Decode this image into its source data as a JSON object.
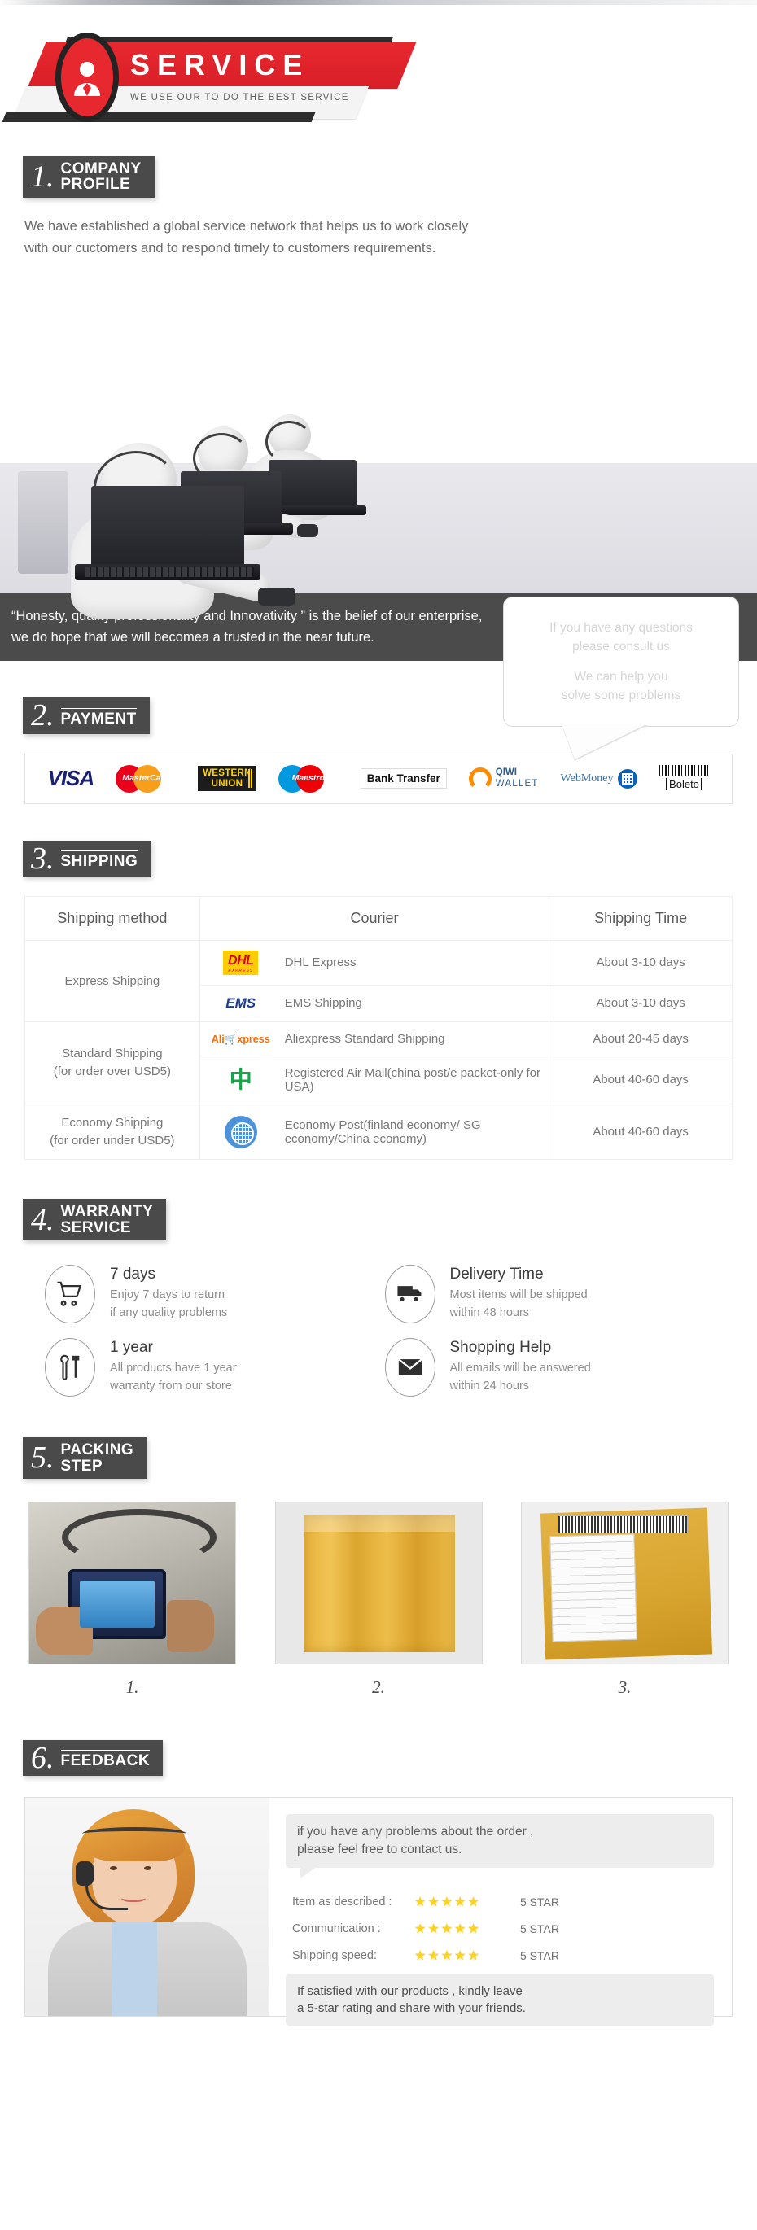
{
  "banner": {
    "title": "SERVICE",
    "subtitle": "WE USE OUR TO DO THE BEST SERVICE",
    "icon": "person-avatar-icon",
    "red": "#e8282f",
    "dark": "#2d2d2d"
  },
  "sections": {
    "profile": {
      "number": "1.",
      "label_line1": "COMPANY",
      "label_line2": "PROFILE",
      "paragraph_line1": "We have established a global service network that helps us to work closely",
      "paragraph_line2": "with our cuctomers and to respond timely to customers requirements.",
      "bubble_line1": "If you have any questions",
      "bubble_line2": "please consult us",
      "bubble_line3": "We can help you",
      "bubble_line4": "solve some problems",
      "quote_line1": "“Honesty, quality professionality and Innovativity ”  is the belief of our enterprise,",
      "quote_line2": "we do hope that we will becomea a trusted in the near future."
    },
    "payment": {
      "number": "2.",
      "label": "PAYMENT",
      "methods": [
        {
          "name": "VISA",
          "icon": "visa-logo"
        },
        {
          "name": "MasterCard",
          "icon": "mastercard-logo"
        },
        {
          "name": "WESTERN UNION",
          "line1": "WESTERN",
          "line2": "UNION",
          "icon": "western-union-logo"
        },
        {
          "name": "Maestro",
          "icon": "maestro-logo"
        },
        {
          "name": "Bank Transfer",
          "icon": "bank-transfer-logo"
        },
        {
          "name": "QIWI WALLET",
          "line1": "QIWI",
          "line2": "WALLET",
          "icon": "qiwi-wallet-logo"
        },
        {
          "name": "WebMoney",
          "icon": "webmoney-logo"
        },
        {
          "name": "Boleto",
          "icon": "boleto-logo"
        }
      ]
    },
    "shipping": {
      "number": "3.",
      "label": "SHIPPING",
      "columns": [
        "Shipping method",
        "Courier",
        "Shipping Time"
      ],
      "rows": [
        {
          "method": "Express Shipping",
          "method_line2": "",
          "items": [
            {
              "logo": "dhl-logo",
              "courier": "DHL Express",
              "time": "About 3-10 days"
            },
            {
              "logo": "ems-logo",
              "courier": "EMS Shipping",
              "time": "About 3-10 days"
            }
          ]
        },
        {
          "method": "Standard Shipping",
          "method_line2": "(for order over USD5)",
          "items": [
            {
              "logo": "aliexpress-logo",
              "courier": "Aliexpress Standard Shipping",
              "time": "About 20-45 days"
            },
            {
              "logo": "china-post-logo",
              "courier": "Registered Air Mail(china post/e packet-only for USA)",
              "time": "About 40-60 days"
            }
          ]
        },
        {
          "method": "Economy Shipping",
          "method_line2": "(for order under USD5)",
          "items": [
            {
              "logo": "un-post-logo",
              "courier": "Economy Post(finland economy/ SG economy/China economy)",
              "time": "About 40-60 days"
            }
          ]
        }
      ]
    },
    "warranty": {
      "number": "4.",
      "label_line1": "WARRANTY",
      "label_line2": "SERVICE",
      "items": [
        {
          "icon": "shopping-cart-icon",
          "title": "7 days",
          "desc_line1": "Enjoy 7 days to return",
          "desc_line2": "if any quality problems"
        },
        {
          "icon": "truck-icon",
          "title": "Delivery Time",
          "desc_line1": "Most items will be shipped",
          "desc_line2": "within 48 hours"
        },
        {
          "icon": "tools-icon",
          "title": "1 year",
          "desc_line1": "All products have 1 year",
          "desc_line2": "warranty from our store"
        },
        {
          "icon": "envelope-icon",
          "title": "Shopping Help",
          "desc_line1": "All emails will be answered",
          "desc_line2": "within 24 hours"
        }
      ]
    },
    "packing": {
      "number": "5.",
      "label_line1": "PACKING",
      "label_line2": "STEP",
      "steps": [
        {
          "caption": "1.",
          "alt": "product-held-in-hands-photo"
        },
        {
          "caption": "2.",
          "alt": "yellow-bubble-envelope-photo"
        },
        {
          "caption": "3.",
          "alt": "packed-parcel-with-shipping-label-photo"
        }
      ]
    },
    "feedback": {
      "number": "6.",
      "label": "FEEDBACK",
      "photo_alt": "female-support-agent-with-headset-photo",
      "bubble_line1": "if you have any problems about the order ,",
      "bubble_line2": "please feel free to contact us.",
      "ratings": [
        {
          "label": "Item as described :",
          "stars": "★★★★★",
          "value": "5 STAR"
        },
        {
          "label": "Communication :",
          "stars": "★★★★★",
          "value": "5 STAR"
        },
        {
          "label": "Shipping speed:",
          "stars": "★★★★★",
          "value": "5 STAR"
        }
      ],
      "note_line1": "If satisfied with our products ,  kindly leave",
      "note_line2": "a 5-star rating and share with your friends."
    }
  }
}
